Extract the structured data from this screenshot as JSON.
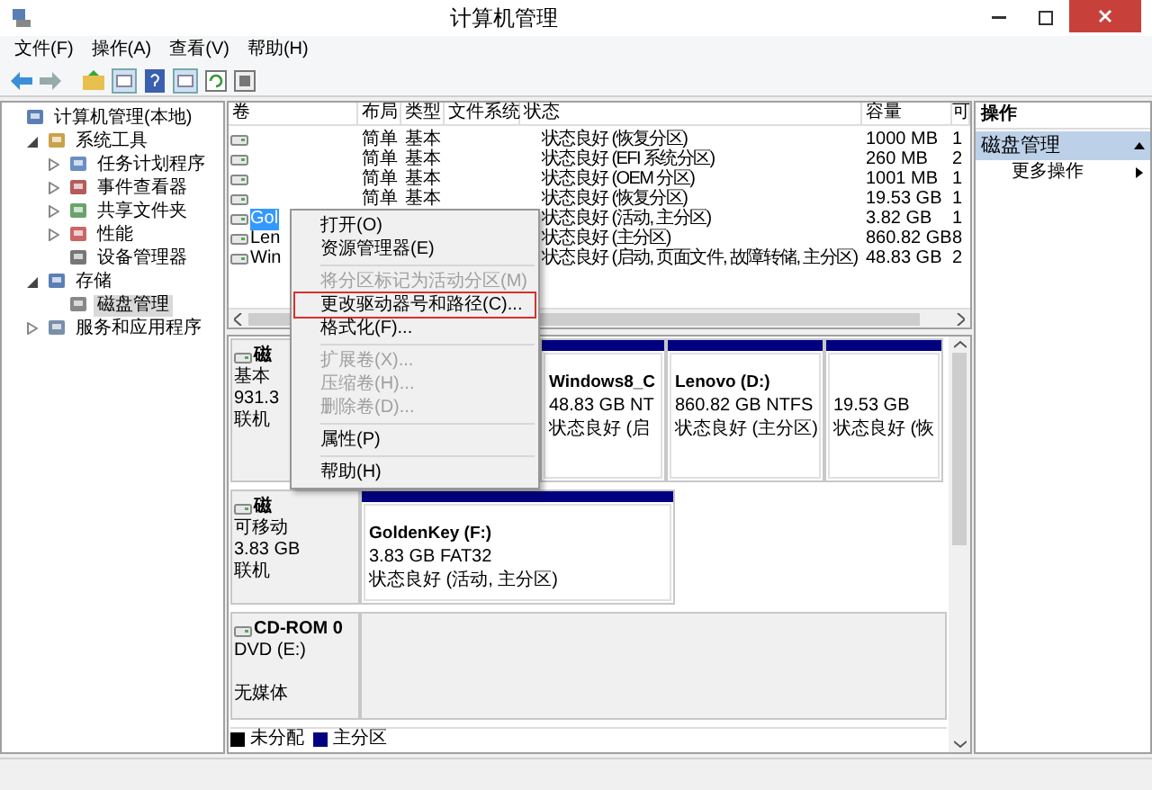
{
  "window": {
    "title": "计算机管理"
  },
  "menu": [
    "文件(F)",
    "操作(A)",
    "查看(V)",
    "帮助(H)"
  ],
  "tree": [
    {
      "label": "计算机管理(本地)",
      "selected": false,
      "children": [
        {
          "label": "系统工具",
          "expanded": true,
          "selected": false,
          "children": [
            {
              "label": "任务计划程序",
              "expanded": false,
              "selected": false
            },
            {
              "label": "事件查看器",
              "expanded": false,
              "selected": false
            },
            {
              "label": "共享文件夹",
              "expanded": false,
              "selected": false
            },
            {
              "label": "性能",
              "expanded": false,
              "selected": false
            },
            {
              "label": "设备管理器",
              "selected": false
            }
          ]
        },
        {
          "label": "存储",
          "expanded": true,
          "selected": false,
          "children": [
            {
              "label": "磁盘管理",
              "selected": true
            }
          ]
        },
        {
          "label": "服务和应用程序",
          "expanded": false,
          "selected": false
        }
      ]
    }
  ],
  "table": {
    "columns": [
      "卷",
      "布局",
      "类型",
      "文件系统",
      "状态",
      "容量",
      "可"
    ],
    "rows": [
      {
        "layout": "简单",
        "type": "基本",
        "status": "状态良好 (恢复分区)",
        "capacity": "1000 MB",
        "column_7": "1",
        "selected": false
      },
      {
        "layout": "简单",
        "type": "基本",
        "status": "状态良好 (EFI 系统分区)",
        "capacity": "260 MB",
        "column_7": "2",
        "selected": false
      },
      {
        "layout": "简单",
        "type": "基本",
        "status": "状态良好 (OEM 分区)",
        "capacity": "1001 MB",
        "column_7": "1",
        "selected": false
      },
      {
        "layout": "简单",
        "type": "基本",
        "status": "状态良好 (恢复分区)",
        "capacity": "19.53 GB",
        "column_7": "1",
        "selected": false
      },
      {
        "volume": "Gol",
        "status": "状态良好 (活动, 主分区)",
        "capacity": "3.82 GB",
        "column_7": "1",
        "selected": true
      },
      {
        "volume": "Len",
        "status": "状态良好 (主分区)",
        "capacity": "860.82 GB",
        "column_7": "8",
        "selected": false
      },
      {
        "volume": "Win",
        "status": "状态良好 (启动, 页面文件, 故障转储, 主分区)",
        "capacity": "48.83 GB",
        "column_7": "2",
        "selected": false
      }
    ]
  },
  "disks": [
    {
      "name": "磁",
      "lines": [
        "基本",
        "931.3",
        "联机"
      ],
      "partitions": [
        {
          "kind": "volume",
          "name": "Windows8_C",
          "lines": [
            "48.83 GB NT",
            "状态良好 (启"
          ]
        },
        {
          "kind": "volume",
          "name": "Lenovo  (D:)",
          "lines": [
            "860.82 GB NTFS",
            "状态良好 (主分区)"
          ]
        },
        {
          "kind": "volume",
          "lines": [
            "19.53 GB",
            "状态良好 (恢"
          ]
        }
      ]
    },
    {
      "name": "磁",
      "lines": [
        "可移动",
        "3.83 GB",
        "联机"
      ],
      "partitions": [
        {
          "kind": "volume",
          "name": "GoldenKey  (F:)",
          "lines": [
            "3.83 GB FAT32",
            "状态良好 (活动, 主分区)"
          ]
        }
      ]
    },
    {
      "name": "CD-ROM 0",
      "lines": [
        "DVD (E:)"
      ],
      "note": "无媒体"
    }
  ],
  "legend": [
    {
      "label": "未分配",
      "color": "#000000"
    },
    {
      "label": "主分区",
      "color": "#000080"
    }
  ],
  "actions": {
    "title": "操作",
    "section": "磁盘管理",
    "items": [
      "更多操作"
    ]
  },
  "context_menu": [
    {
      "kind": "item",
      "label": "打开(O)",
      "disabled": false,
      "outlined": false
    },
    {
      "kind": "item",
      "label": "资源管理器(E)",
      "disabled": false,
      "outlined": false
    },
    {
      "kind": "separator"
    },
    {
      "kind": "item",
      "label": "将分区标记为活动分区(M)",
      "disabled": true,
      "outlined": false
    },
    {
      "kind": "item",
      "label": "更改驱动器号和路径(C)...",
      "disabled": false,
      "outlined": true
    },
    {
      "kind": "item",
      "label": "格式化(F)...",
      "disabled": false,
      "outlined": false
    },
    {
      "kind": "separator"
    },
    {
      "kind": "item",
      "label": "扩展卷(X)...",
      "disabled": true,
      "outlined": false
    },
    {
      "kind": "item",
      "label": "压缩卷(H)...",
      "disabled": true,
      "outlined": false
    },
    {
      "kind": "item",
      "label": "删除卷(D)...",
      "disabled": true,
      "outlined": false
    },
    {
      "kind": "separator"
    },
    {
      "kind": "item",
      "label": "属性(P)",
      "disabled": false,
      "outlined": false
    },
    {
      "kind": "separator"
    },
    {
      "kind": "item",
      "label": "帮助(H)",
      "disabled": false,
      "outlined": false
    }
  ]
}
